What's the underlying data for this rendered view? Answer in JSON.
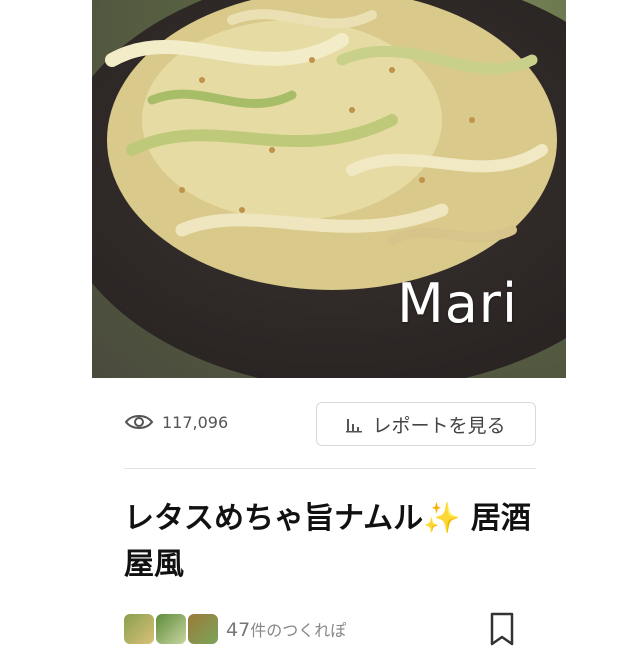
{
  "photo": {
    "watermark": "Mari"
  },
  "stats": {
    "views": "117,096"
  },
  "report_button": {
    "label": "レポートを見る"
  },
  "recipe": {
    "title": "レタスめちゃ旨ナムル✨ 居酒屋風"
  },
  "tsukurepo": {
    "count": "47",
    "suffix": "件のつくれぽ"
  },
  "icons": [
    "eye-icon",
    "bar-chart-icon",
    "bookmark-icon"
  ]
}
